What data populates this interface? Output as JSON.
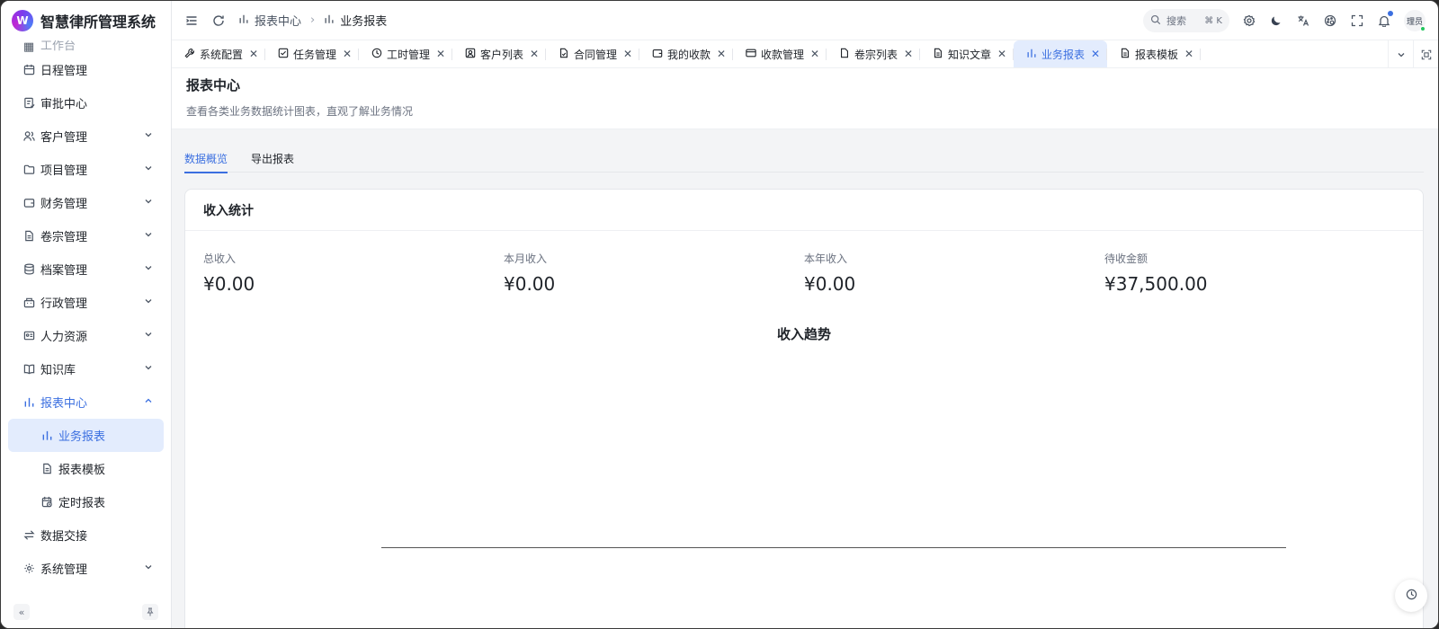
{
  "app": {
    "title": "智慧律所管理系统",
    "logo_letter": "W"
  },
  "sidebar": {
    "cut_item": "工作台",
    "items": [
      {
        "label": "日程管理",
        "icon": "calendar-icon"
      },
      {
        "label": "审批中心",
        "icon": "approval-icon"
      },
      {
        "label": "客户管理",
        "icon": "users-icon"
      },
      {
        "label": "项目管理",
        "icon": "folder-icon"
      },
      {
        "label": "财务管理",
        "icon": "wallet-icon"
      },
      {
        "label": "卷宗管理",
        "icon": "file-icon"
      },
      {
        "label": "档案管理",
        "icon": "database-icon"
      },
      {
        "label": "行政管理",
        "icon": "building-icon"
      },
      {
        "label": "人力资源",
        "icon": "id-card-icon"
      },
      {
        "label": "知识库",
        "icon": "book-icon"
      },
      {
        "label": "报表中心",
        "icon": "bar-chart-icon"
      },
      {
        "label": "业务报表",
        "icon": "bar-chart-icon"
      },
      {
        "label": "报表模板",
        "icon": "file-icon"
      },
      {
        "label": "定时报表",
        "icon": "calendar-clock-icon"
      },
      {
        "label": "数据交接",
        "icon": "swap-icon"
      },
      {
        "label": "系统管理",
        "icon": "gear-icon"
      }
    ]
  },
  "header": {
    "breadcrumb": [
      "报表中心",
      "业务报表"
    ],
    "search_label": "搜索",
    "search_kbd": "⌘ K",
    "user_label": "理员"
  },
  "tabs": [
    "系统配置",
    "任务管理",
    "工时管理",
    "客户列表",
    "合同管理",
    "我的收款",
    "收款管理",
    "卷宗列表",
    "知识文章",
    "业务报表",
    "报表模板"
  ],
  "page": {
    "title": "报表中心",
    "description": "查看各类业务数据统计图表，直观了解业务情况",
    "inner_tabs": [
      "数据概览",
      "导出报表"
    ]
  },
  "card": {
    "title": "收入统计",
    "stats": [
      {
        "label": "总收入",
        "value": "¥0.00"
      },
      {
        "label": "本月收入",
        "value": "¥0.00"
      },
      {
        "label": "本年收入",
        "value": "¥0.00"
      },
      {
        "label": "待收金额",
        "value": "¥37,500.00"
      }
    ],
    "trend_title": "收入趋势"
  },
  "colors": {
    "accent": "#3b6fe0",
    "active_bg": "#e3ecfd"
  }
}
